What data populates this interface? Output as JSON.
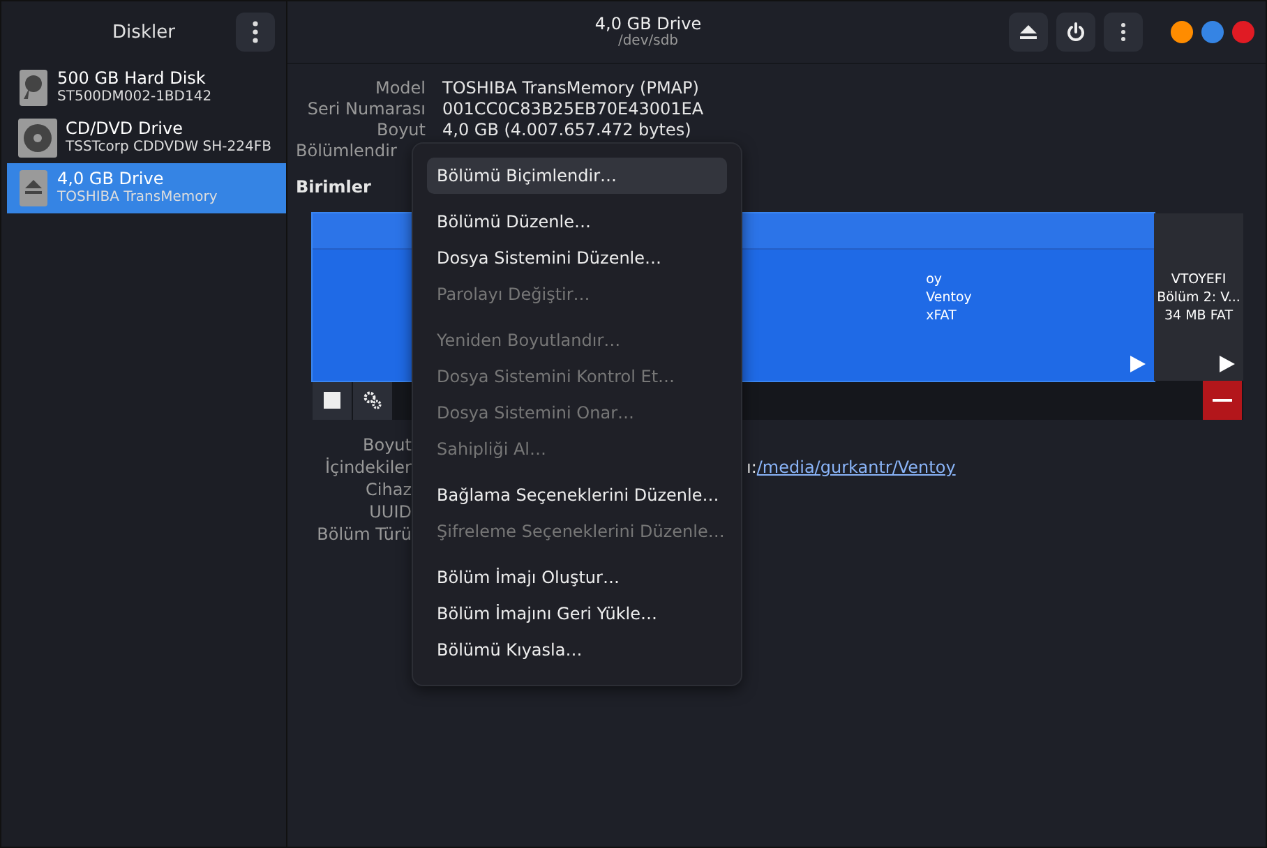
{
  "sidebar": {
    "title": "Diskler",
    "items": [
      {
        "kind": "hdd",
        "name": "500 GB Hard Disk",
        "model": "ST500DM002-1BD142",
        "selected": false
      },
      {
        "kind": "optical",
        "name": "CD/DVD Drive",
        "model": "TSSTcorp CDDVDW SH-224FB",
        "selected": false
      },
      {
        "kind": "removable",
        "name": "4,0 GB Drive",
        "model": "TOSHIBA TransMemory",
        "selected": true
      }
    ]
  },
  "header": {
    "title": "4,0 GB Drive",
    "subtitle": "/dev/sdb"
  },
  "drive_info": [
    {
      "label": "Model",
      "value": "TOSHIBA TransMemory (PMAP)"
    },
    {
      "label": "Seri Numarası",
      "value": "001CC0C83B25EB70E43001EA"
    },
    {
      "label": "Boyut",
      "value": "4,0 GB (4.007.657.472 bytes)"
    },
    {
      "label": "Bölümlendir"
    }
  ],
  "volumes_heading": "Birimler",
  "partitions": [
    {
      "kind": "main",
      "lines": [
        "oy",
        "Ventoy",
        "xFAT"
      ],
      "selected": true
    },
    {
      "kind": "small",
      "lines": [
        "VTOYEFI",
        "Bölüm 2: V...",
        "34 MB FAT"
      ],
      "selected": false
    }
  ],
  "volume_info": [
    {
      "label": "Boyut"
    },
    {
      "label": "İçindekiler",
      "value": "ı: ",
      "link": "/media/gurkantr/Ventoy"
    },
    {
      "label": "Cihaz"
    },
    {
      "label": "UUID"
    },
    {
      "label": "Bölüm Türü"
    }
  ],
  "menu": [
    {
      "label": "Bölümü Biçimlendir…",
      "disabled": false,
      "selected": true
    },
    {
      "kind": "separator"
    },
    {
      "label": "Bölümü Düzenle…",
      "disabled": false,
      "selected": false
    },
    {
      "label": "Dosya Sistemini Düzenle…",
      "disabled": false,
      "selected": false
    },
    {
      "label": "Parolayı Değiştir…",
      "disabled": true,
      "selected": false
    },
    {
      "kind": "separator"
    },
    {
      "label": "Yeniden Boyutlandır…",
      "disabled": true,
      "selected": false
    },
    {
      "label": "Dosya Sistemini Kontrol Et…",
      "disabled": true,
      "selected": false
    },
    {
      "label": "Dosya Sistemini Onar…",
      "disabled": true,
      "selected": false
    },
    {
      "label": "Sahipliği Al…",
      "disabled": true,
      "selected": false
    },
    {
      "kind": "separator"
    },
    {
      "label": "Bağlama Seçeneklerini Düzenle…",
      "disabled": false,
      "selected": false
    },
    {
      "label": "Şifreleme Seçeneklerini Düzenle…",
      "disabled": true,
      "selected": false
    },
    {
      "kind": "separator"
    },
    {
      "label": "Bölüm İmajı Oluştur…",
      "disabled": false,
      "selected": false
    },
    {
      "label": "Bölüm İmajını Geri Yükle…",
      "disabled": false,
      "selected": false
    },
    {
      "label": "Bölümü Kıyasla…",
      "disabled": false,
      "selected": false
    }
  ]
}
